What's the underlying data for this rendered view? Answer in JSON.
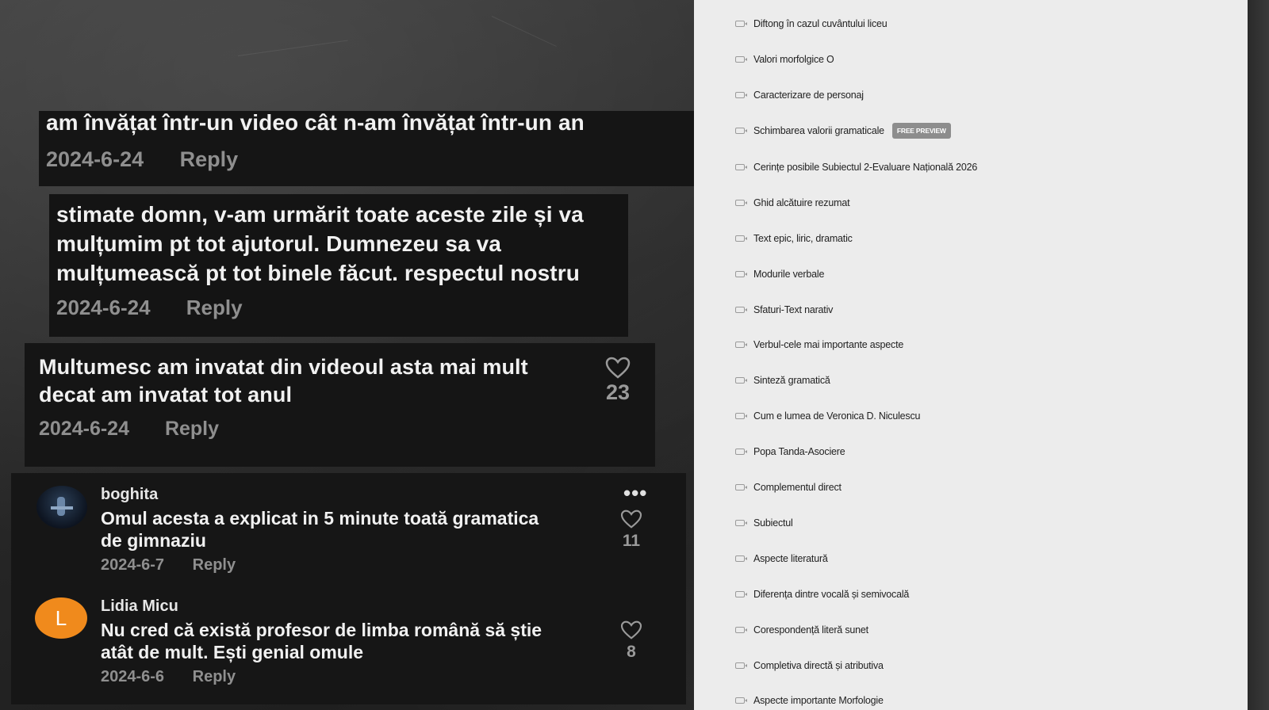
{
  "comments": {
    "c1": {
      "text": "am învățat într-un video cât n-am învățat într-un an",
      "date": "2024-6-24",
      "reply": "Reply"
    },
    "c2": {
      "lines": [
        "stimate domn, v-am urmărit toate aceste zile și va",
        "mulțumim pt tot ajutorul. Dumnezeu sa va",
        "mulțumească pt tot binele făcut. respectul nostru"
      ],
      "date": "2024-6-24",
      "reply": "Reply"
    },
    "c3": {
      "lines": [
        "Multumesc am invatat din videoul asta mai mult",
        "decat am invatat tot anul"
      ],
      "date": "2024-6-24",
      "reply": "Reply",
      "likes": "23"
    },
    "c4": {
      "username": "boghita",
      "lines": [
        "Omul acesta a explicat in 5 minute toată gramatica",
        "de gimnaziu"
      ],
      "date": "2024-6-7",
      "reply": "Reply",
      "likes": "11",
      "more": "•••"
    },
    "c5": {
      "username": "Lidia Micu",
      "avatar_letter": "L",
      "avatar_color": "#f08a1c",
      "lines": [
        "Nu cred că există profesor de limba română să știe",
        "atât de mult. Ești genial omule"
      ],
      "date": "2024-6-6",
      "reply": "Reply",
      "likes": "8"
    }
  },
  "lessons": [
    {
      "title": "Diftong în cazul cuvântului liceu"
    },
    {
      "title": "Valori morfolgice O"
    },
    {
      "title": "Caracterizare de personaj"
    },
    {
      "title": "Schimbarea valorii gramaticale",
      "badge": "FREE PREVIEW"
    },
    {
      "title": "Cerințe posibile Subiectul 2-Evaluare Națională 2026"
    },
    {
      "title": "Ghid alcătuire rezumat"
    },
    {
      "title": "Text epic, liric, dramatic"
    },
    {
      "title": "Modurile verbale"
    },
    {
      "title": "Sfaturi-Text narativ"
    },
    {
      "title": "Verbul-cele mai importante aspecte"
    },
    {
      "title": "Sinteză gramatică"
    },
    {
      "title": "Cum e lumea de Veronica D. Niculescu"
    },
    {
      "title": "Popa Tanda-Asociere"
    },
    {
      "title": "Complementul direct"
    },
    {
      "title": "Subiectul"
    },
    {
      "title": "Aspecte literatură"
    },
    {
      "title": "Diferența dintre vocală și semivocală"
    },
    {
      "title": "Corespondență literă sunet"
    },
    {
      "title": "Completiva directă și atributiva"
    },
    {
      "title": "Aspecte importante Morfologie"
    }
  ],
  "colors": {
    "panel_bg": "#ececec",
    "card_bg": "#151515",
    "badge_bg": "#8d8d8d"
  }
}
